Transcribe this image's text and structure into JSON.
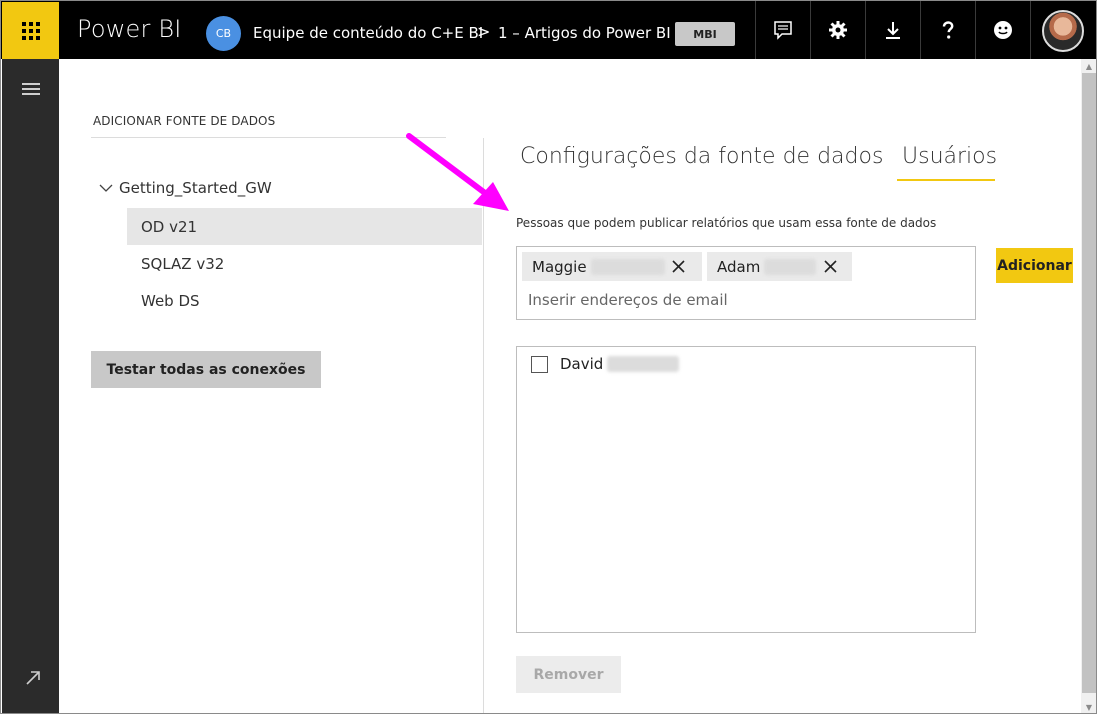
{
  "app": {
    "title": "Power BI"
  },
  "header": {
    "workspace_initials": "CB",
    "workspace_name": "Equipe de conteúdo do C+E BI",
    "separator": ">",
    "item_name": "1 – Artigos do Power BI",
    "badge": "MBI",
    "icons": [
      "comment-icon",
      "gear-icon",
      "download-icon",
      "help-icon",
      "smiley-icon"
    ]
  },
  "left_panel": {
    "section_title": "ADICIONAR FONTE DE DADOS",
    "gateway": "Getting_Started_GW",
    "data_sources": [
      "OD v21",
      "SQLAZ v32",
      "Web DS"
    ],
    "selected_index": 0,
    "test_button": "Testar todas as conexões"
  },
  "tabs": {
    "config": "Configurações da fonte de dados",
    "users": "Usuários",
    "active": "users"
  },
  "users_panel": {
    "description": "Pessoas que podem publicar relatórios que usam essa fonte de dados",
    "chips": [
      {
        "name": "Maggie"
      },
      {
        "name": "Adam"
      }
    ],
    "email_placeholder": "Inserir endereços de email",
    "add_button": "Adicionar",
    "users": [
      {
        "name": "David",
        "checked": false
      }
    ],
    "remove_button": "Remover"
  },
  "colors": {
    "accent": "#f2c811",
    "topbar": "#000000",
    "rail": "#2b2b2b",
    "annotation_arrow": "#ff00ff",
    "workspace_avatar": "#4a90e2"
  }
}
